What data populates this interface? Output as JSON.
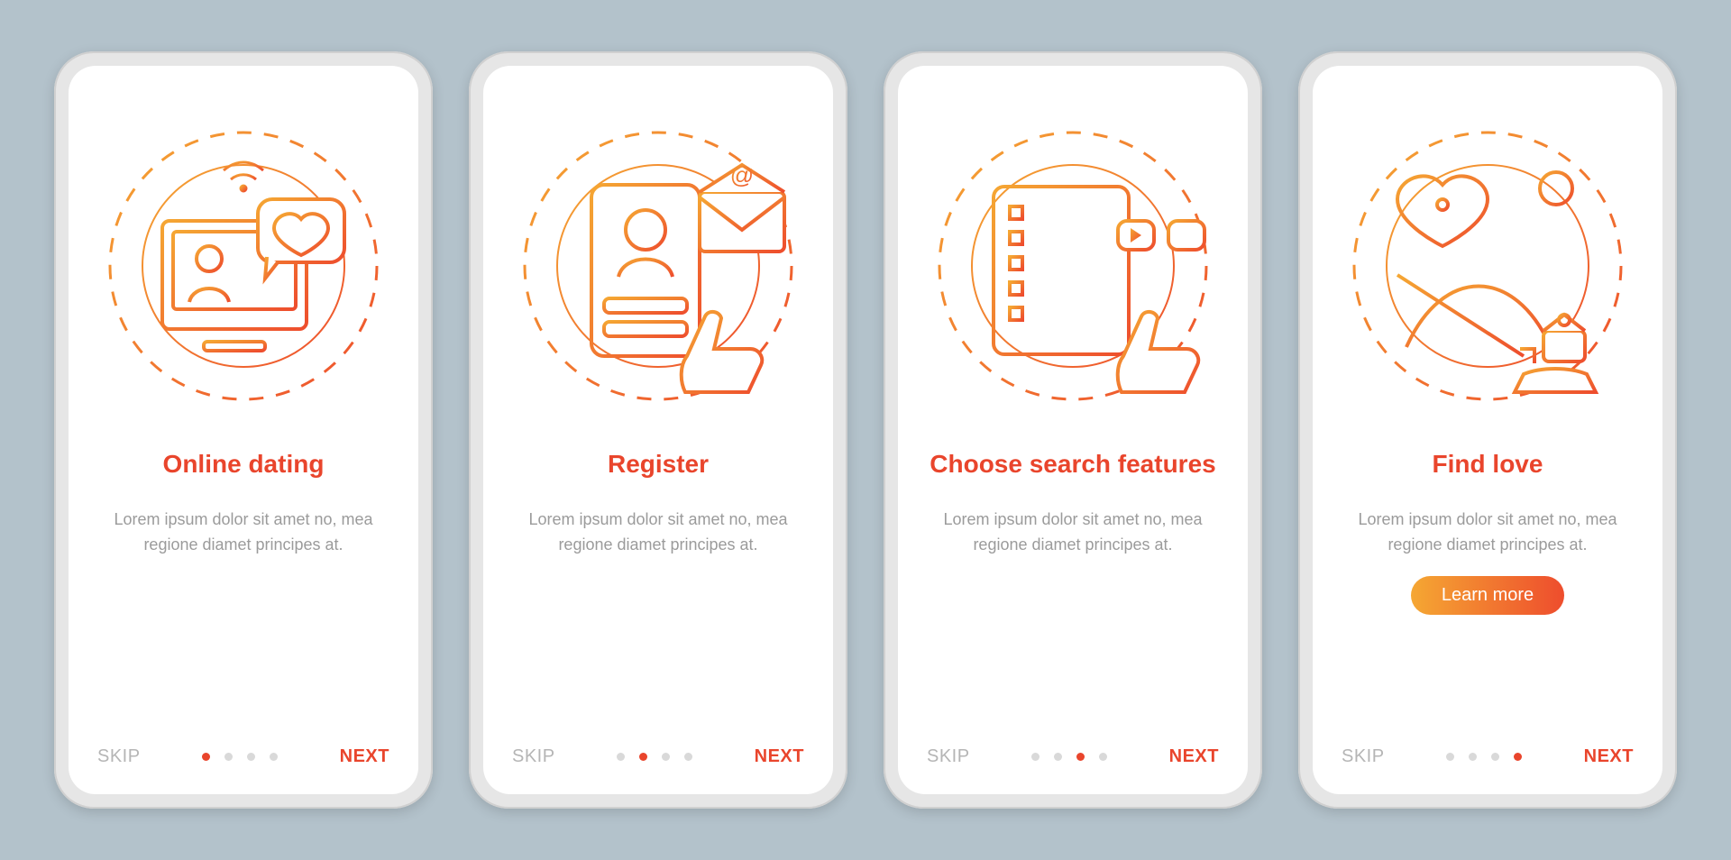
{
  "colors": {
    "accent": "#e9452c",
    "grad_a": "#f5a733",
    "grad_b": "#ee4d2d",
    "muted": "#9b9b9b"
  },
  "common": {
    "skip": "SKIP",
    "next": "NEXT",
    "body": "Lorem ipsum dolor sit amet no, mea regione diamet principes at."
  },
  "cta_label": "Learn more",
  "slides": [
    {
      "title": "Online dating",
      "icon": "online-dating-icon",
      "cta": false
    },
    {
      "title": "Register",
      "icon": "register-icon",
      "cta": false
    },
    {
      "title": "Choose search features",
      "icon": "choose-search-icon",
      "cta": false
    },
    {
      "title": "Find love",
      "icon": "find-love-icon",
      "cta": true
    }
  ]
}
